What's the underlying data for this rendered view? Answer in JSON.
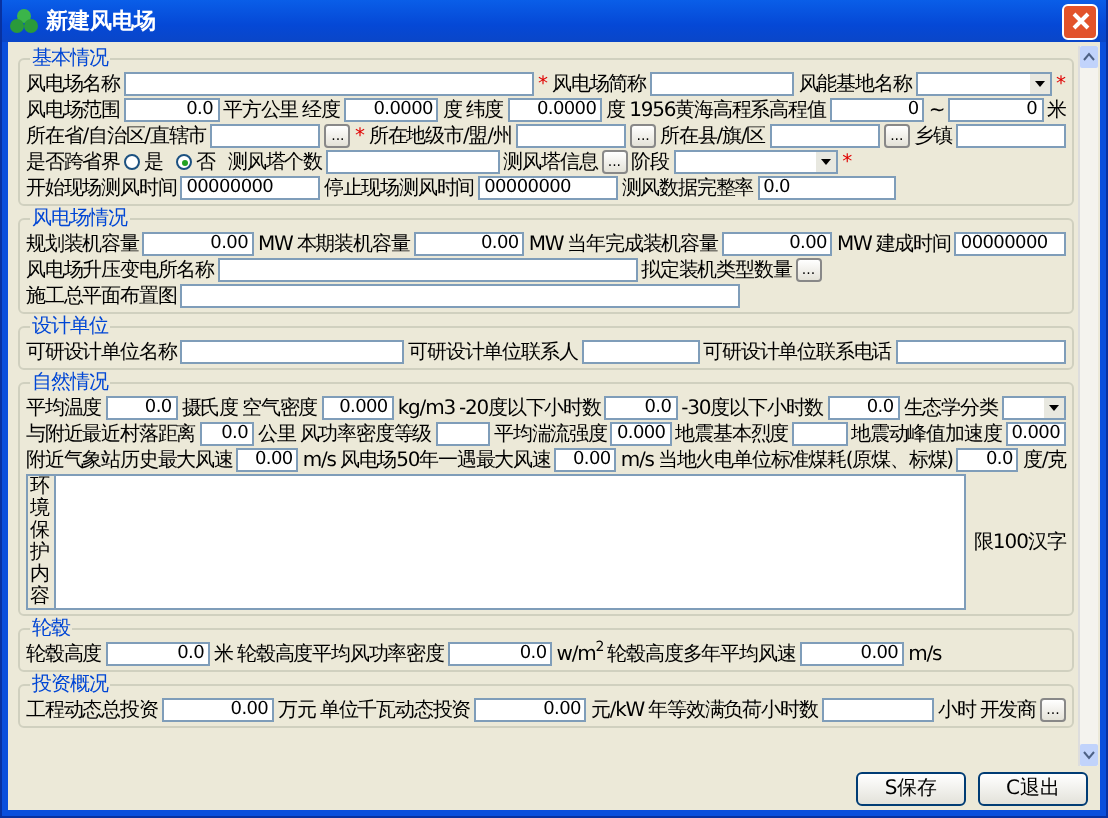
{
  "window": {
    "title": "新建风电场"
  },
  "sections": [
    {
      "title": "基本情况",
      "lines": [
        {
          "items": [
            {
              "kind": "label",
              "text": "风电场名称"
            },
            {
              "kind": "field"
            },
            {
              "kind": "required",
              "text": "*"
            },
            {
              "kind": "label",
              "text": "风电场简称"
            },
            {
              "kind": "field"
            },
            {
              "kind": "label",
              "text": "风能基地名称"
            },
            {
              "kind": "select"
            },
            {
              "kind": "required",
              "text": "*"
            }
          ]
        },
        {
          "items": [
            {
              "kind": "label",
              "text": "风电场范围"
            },
            {
              "kind": "number",
              "value": "0.0"
            },
            {
              "kind": "label",
              "text": "平方公里"
            },
            {
              "kind": "label",
              "text": "经度"
            },
            {
              "kind": "number",
              "value": "0.0000"
            },
            {
              "kind": "label",
              "text": "度"
            },
            {
              "kind": "label",
              "text": "纬度"
            },
            {
              "kind": "number",
              "value": "0.0000"
            },
            {
              "kind": "label",
              "text": "度"
            },
            {
              "kind": "label",
              "text": "1956黄海高程系高程值"
            },
            {
              "kind": "number",
              "value": "0"
            },
            {
              "kind": "label",
              "text": "~"
            },
            {
              "kind": "number",
              "value": "0"
            },
            {
              "kind": "label",
              "text": "米"
            }
          ]
        },
        {
          "items": [
            {
              "kind": "label",
              "text": "所在省/自治区/直辖市"
            },
            {
              "kind": "field"
            },
            {
              "kind": "browse",
              "text": "..."
            },
            {
              "kind": "required",
              "text": "*"
            },
            {
              "kind": "label",
              "text": "所在地级市/盟/州"
            },
            {
              "kind": "field"
            },
            {
              "kind": "browse",
              "text": "..."
            },
            {
              "kind": "label",
              "text": "所在县/旗/区"
            },
            {
              "kind": "field"
            },
            {
              "kind": "browse",
              "text": "..."
            },
            {
              "kind": "label",
              "text": "乡镇"
            },
            {
              "kind": "field"
            }
          ]
        },
        {
          "items": [
            {
              "kind": "label",
              "text": "是否跨省界"
            },
            {
              "kind": "radio",
              "text": "是",
              "selected": false
            },
            {
              "kind": "radio",
              "text": "否",
              "selected": true
            },
            {
              "kind": "label",
              "text": "测风塔个数"
            },
            {
              "kind": "field"
            },
            {
              "kind": "label",
              "text": "测风塔信息"
            },
            {
              "kind": "browse",
              "text": "..."
            },
            {
              "kind": "label",
              "text": "阶段"
            },
            {
              "kind": "select"
            },
            {
              "kind": "required",
              "text": "*"
            },
            {
              "kind": "gap"
            }
          ]
        },
        {
          "items": [
            {
              "kind": "label",
              "text": "开始现场测风时间"
            },
            {
              "kind": "field",
              "value": "00000000"
            },
            {
              "kind": "label",
              "text": "停止现场测风时间"
            },
            {
              "kind": "field",
              "value": "00000000"
            },
            {
              "kind": "label",
              "text": "测风数据完整率"
            },
            {
              "kind": "field",
              "value": "0.0"
            },
            {
              "kind": "gap"
            }
          ]
        }
      ]
    },
    {
      "title": "风电场情况",
      "lines": [
        {
          "items": [
            {
              "kind": "label",
              "text": "规划装机容量"
            },
            {
              "kind": "number",
              "value": "0.00"
            },
            {
              "kind": "label",
              "text": "MW"
            },
            {
              "kind": "label",
              "text": "本期装机容量"
            },
            {
              "kind": "number",
              "value": "0.00"
            },
            {
              "kind": "label",
              "text": "MW"
            },
            {
              "kind": "label",
              "text": "当年完成装机容量"
            },
            {
              "kind": "number",
              "value": "0.00"
            },
            {
              "kind": "label",
              "text": "MW"
            },
            {
              "kind": "label",
              "text": "建成时间"
            },
            {
              "kind": "field",
              "value": "00000000"
            }
          ]
        },
        {
          "items": [
            {
              "kind": "label",
              "text": "风电场升压变电所名称"
            },
            {
              "kind": "field"
            },
            {
              "kind": "label",
              "text": "拟定装机类型数量"
            },
            {
              "kind": "browse",
              "text": "..."
            },
            {
              "kind": "gap"
            }
          ]
        },
        {
          "items": [
            {
              "kind": "label",
              "text": "施工总平面布置图"
            },
            {
              "kind": "field"
            },
            {
              "kind": "gap"
            }
          ]
        }
      ]
    },
    {
      "title": "设计单位",
      "lines": [
        {
          "items": [
            {
              "kind": "label",
              "text": "可研设计单位名称"
            },
            {
              "kind": "field"
            },
            {
              "kind": "label",
              "text": "可研设计单位联系人"
            },
            {
              "kind": "field"
            },
            {
              "kind": "label",
              "text": "可研设计单位联系电话"
            },
            {
              "kind": "field"
            }
          ]
        }
      ]
    },
    {
      "title": "自然情况",
      "lines": [
        {
          "items": [
            {
              "kind": "label",
              "text": "平均温度"
            },
            {
              "kind": "number",
              "value": "0.0"
            },
            {
              "kind": "label",
              "text": "摄氏度"
            },
            {
              "kind": "label",
              "text": "空气密度"
            },
            {
              "kind": "number",
              "value": "0.000"
            },
            {
              "kind": "label",
              "text": "kg/m3"
            },
            {
              "kind": "label",
              "text": "-20度以下小时数"
            },
            {
              "kind": "number",
              "value": "0.0"
            },
            {
              "kind": "label",
              "text": "-30度以下小时数"
            },
            {
              "kind": "number",
              "value": "0.0"
            },
            {
              "kind": "label",
              "text": "生态学分类"
            },
            {
              "kind": "select"
            }
          ]
        },
        {
          "items": [
            {
              "kind": "label",
              "text": "与附近最近村落距离"
            },
            {
              "kind": "number",
              "value": "0.0"
            },
            {
              "kind": "label",
              "text": "公里"
            },
            {
              "kind": "label",
              "text": "风功率密度等级"
            },
            {
              "kind": "field"
            },
            {
              "kind": "label",
              "text": "平均湍流强度"
            },
            {
              "kind": "number",
              "value": "0.000"
            },
            {
              "kind": "label",
              "text": "地震基本烈度"
            },
            {
              "kind": "field"
            },
            {
              "kind": "label",
              "text": "地震动峰值加速度"
            },
            {
              "kind": "number",
              "value": "0.000"
            }
          ]
        },
        {
          "items": [
            {
              "kind": "label",
              "text": "附近气象站历史最大风速"
            },
            {
              "kind": "number",
              "value": "0.00"
            },
            {
              "kind": "label",
              "text": "m/s"
            },
            {
              "kind": "label",
              "text": "风电场50年一遇最大风速"
            },
            {
              "kind": "number",
              "value": "0.00"
            },
            {
              "kind": "label",
              "text": "m/s"
            },
            {
              "kind": "label",
              "text": "当地火电单位标准煤耗(原煤、标煤)"
            },
            {
              "kind": "number",
              "value": "0.0"
            },
            {
              "kind": "label",
              "text": "度/克"
            }
          ]
        },
        {
          "items": [
            {
              "kind": "memo",
              "label": "环境保护内容",
              "note": "限100汉字"
            }
          ]
        }
      ]
    },
    {
      "title": "轮毂",
      "lines": [
        {
          "items": [
            {
              "kind": "label",
              "text": "轮毂高度"
            },
            {
              "kind": "number",
              "value": "0.0"
            },
            {
              "kind": "label",
              "text": "米"
            },
            {
              "kind": "label",
              "text": "轮毂高度平均风功率密度"
            },
            {
              "kind": "number",
              "value": "0.0"
            },
            {
              "kind": "label",
              "text": "w/m$^{2}$"
            },
            {
              "kind": "label",
              "text": "轮毂高度多年平均风速"
            },
            {
              "kind": "number",
              "value": "0.00"
            },
            {
              "kind": "label",
              "text": "m/s"
            },
            {
              "kind": "gap"
            }
          ]
        }
      ]
    },
    {
      "title": "投资概况",
      "lines": [
        {
          "items": [
            {
              "kind": "label",
              "text": "工程动态总投资"
            },
            {
              "kind": "number",
              "value": "0.00"
            },
            {
              "kind": "label",
              "text": "万元"
            },
            {
              "kind": "label",
              "text": "单位千瓦动态投资"
            },
            {
              "kind": "number",
              "value": "0.00"
            },
            {
              "kind": "label",
              "text": "元/kW"
            },
            {
              "kind": "label",
              "text": "年等效满负荷小时数"
            },
            {
              "kind": "field"
            },
            {
              "kind": "label",
              "text": "小时"
            },
            {
              "kind": "label",
              "text": "开发商"
            },
            {
              "kind": "browse",
              "text": "..."
            }
          ]
        }
      ]
    }
  ],
  "buttons": [
    "S保存",
    "C退出"
  ]
}
